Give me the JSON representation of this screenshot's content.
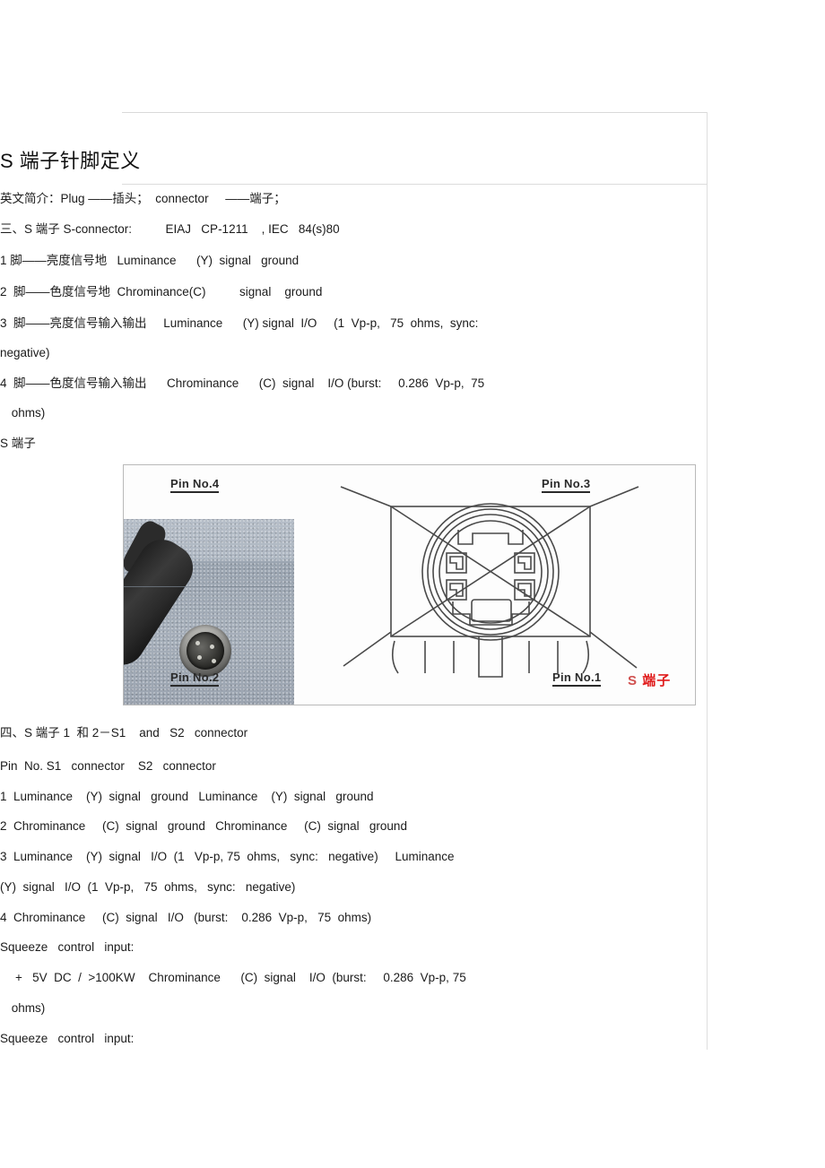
{
  "document": {
    "title": "S 端子针脚定义",
    "paragraphs": [
      {
        "id": "intro",
        "text": "英文简介：Plug ——插头；  connector     ——端子；"
      },
      {
        "id": "section3",
        "text": "三、S 端子 S-connector:          EIAJ   CP-1211    , IEC   84(s)80"
      },
      {
        "id": "pin1",
        "text": "1 脚——亮度信号地   Luminance      (Y)  signal   ground"
      },
      {
        "id": "pin2",
        "text": "2  脚——色度信号地  Chrominance(C)          signal    ground"
      },
      {
        "id": "pin3",
        "text": "3  脚——亮度信号输入输出     Luminance      (Y) signal  I/O     (1  Vp-p,   75  ohms,  sync:"
      },
      {
        "id": "pin3cont",
        "text": "negative)"
      },
      {
        "id": "pin4",
        "text": "4  脚——色度信号输入输出      Chrominance      (C)  signal    I/O (burst:     0.286  Vp-p,  75"
      },
      {
        "id": "pin4cont",
        "text": " ohms)"
      },
      {
        "id": "figcaption",
        "text": "S 端子"
      },
      {
        "id": "section4",
        "text": "四、S 端子 1  和 2－S1    and   S2   connector"
      },
      {
        "id": "tablehead",
        "text": "Pin  No. S1   connector    S2   connector"
      },
      {
        "id": "row1",
        "text": "1  Luminance    (Y)  signal   ground   Luminance    (Y)  signal   ground"
      },
      {
        "id": "row2",
        "text": "2  Chrominance     (C)  signal   ground   Chrominance     (C)  signal   ground"
      },
      {
        "id": "row3",
        "text": "3  Luminance    (Y)  signal   I/O  (1   Vp-p, 75  ohms,   sync:   negative)     Luminance"
      },
      {
        "id": "row3cont",
        "text": "(Y)  signal   I/O  (1  Vp-p,   75  ohms,   sync:   negative)"
      },
      {
        "id": "row4",
        "text": "4  Chrominance     (C)  signal   I/O   (burst:    0.286  Vp-p,   75  ohms)"
      },
      {
        "id": "squeeze1",
        "text": "Squeeze   control   input:"
      },
      {
        "id": "squeeze1detail",
        "text": "+   5V  DC  /  >100KW    Chrominance      (C)  signal    I/O  (burst:     0.286  Vp-p, 75"
      },
      {
        "id": "squeeze1cont",
        "text": " ohms)"
      },
      {
        "id": "squeeze2",
        "text": "Squeeze   control   input:"
      }
    ]
  },
  "figure": {
    "caption_above": "S 端子",
    "pin_labels": {
      "pin4": "Pin No.4",
      "pin3": "Pin No.3",
      "pin2": "Pin No.2",
      "pin1": "Pin No.1"
    },
    "watermark": {
      "letter": "S",
      "chinese": "端子"
    },
    "colors": {
      "watermark_letter": "#d0504f",
      "watermark_chinese": "#e01b1b",
      "drawing_stroke": "#4a4a4a",
      "frame_border": "#b9b9b9"
    },
    "photo_alt": "S-video 4-pin mini-DIN plug photo"
  }
}
